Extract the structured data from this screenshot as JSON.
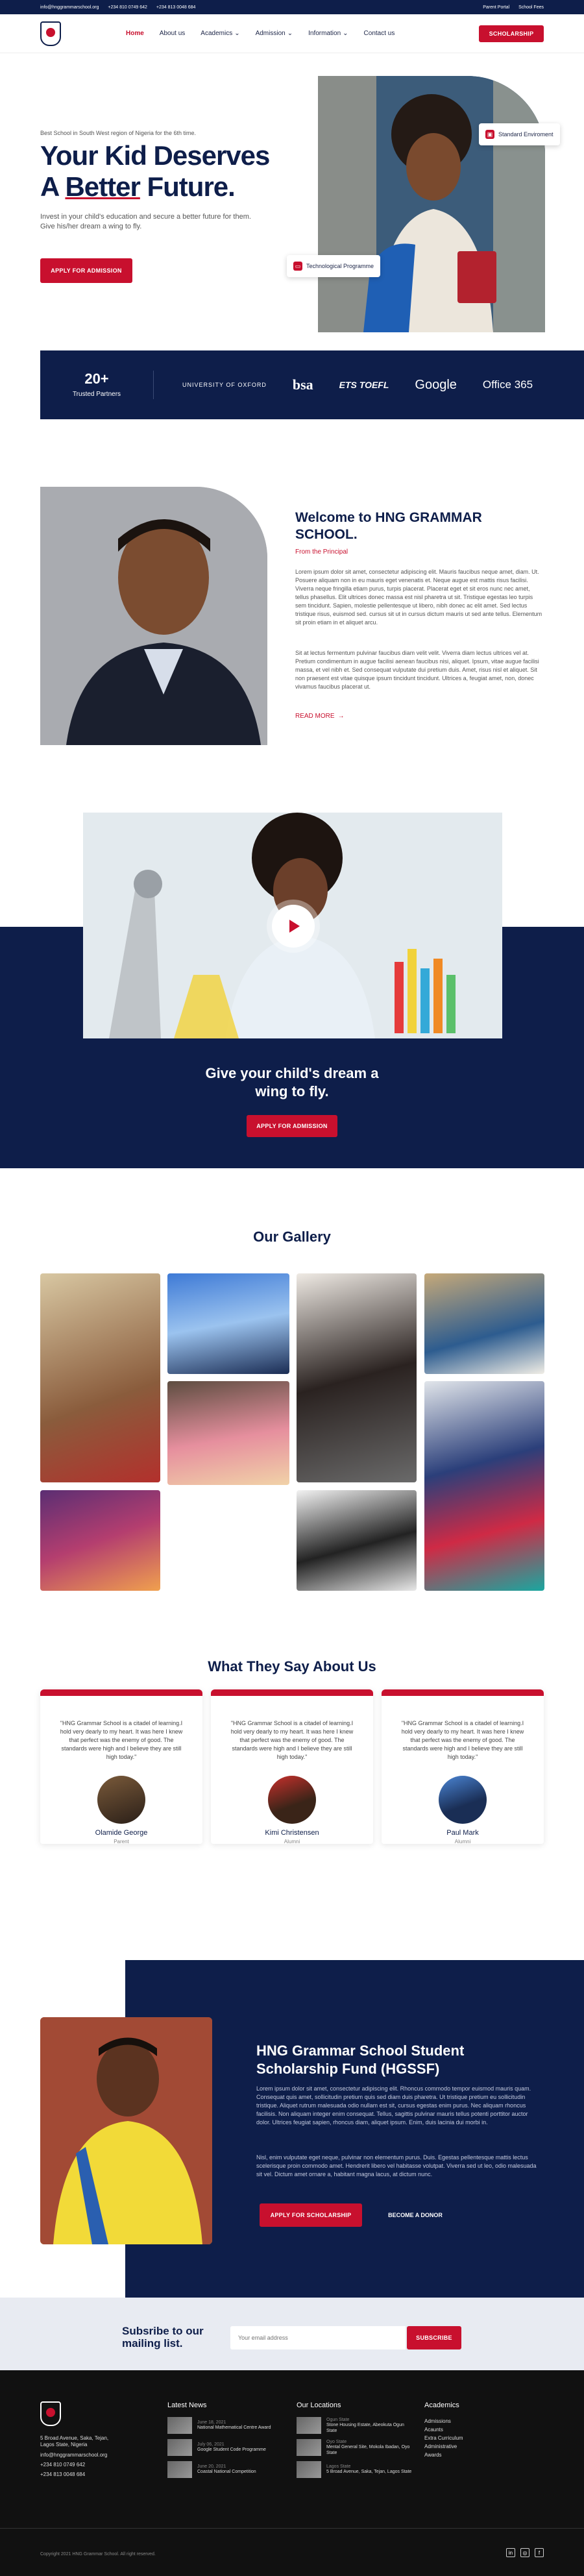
{
  "topbar": {
    "email": "info@hnggrammarschool.org",
    "phone1": "+234 810 0749 642",
    "phone2": "+234 813 0048 684",
    "parent_portal": "Parent Portal",
    "school_fees": "School Fees"
  },
  "nav": {
    "items": [
      {
        "label": "Home",
        "dropdown": false
      },
      {
        "label": "About us",
        "dropdown": false
      },
      {
        "label": "Academics",
        "dropdown": true
      },
      {
        "label": "Admission",
        "dropdown": true
      },
      {
        "label": "Information",
        "dropdown": true
      },
      {
        "label": "Contact us",
        "dropdown": false
      }
    ],
    "cta": "SCHOLARSHIP"
  },
  "hero": {
    "kicker": "Best School in South West region of Nigeria for the 6th time.",
    "title_a": "Your Kid Deserves",
    "title_b1": "A ",
    "title_b2": "Better",
    "title_b3": " Future.",
    "subtitle": "Invest in your child's education and secure a better future for them. Give his/her dream a wing to fly.",
    "cta": "APPLY FOR ADMISSION",
    "badge1": "Standard Enviroment",
    "badge2": "Technological Programme"
  },
  "partners": {
    "count": "20+",
    "label": "Trusted Partners",
    "logos": [
      "UNIVERSITY OF OXFORD",
      "bsa",
      "ETS TOEFL",
      "Google",
      "Office 365"
    ]
  },
  "welcome": {
    "title": "Welcome to HNG GRAMMAR SCHOOL.",
    "subtitle": "From the Principal",
    "p1": "Lorem ipsum dolor sit amet, consectetur adipiscing elit. Mauris faucibus neque amet, diam. Ut. Posuere aliquam non in eu mauris eget venenatis et. Neque augue est mattis risus facilisi. Viverra neque fringilla etiam purus, turpis placerat. Placerat eget et sit eros nunc nec amet, tellus phasellus. Elit ultrices donec massa est nisl pharetra ut sit. Tristique egestas leo turpis sem tincidunt. Sapien, molestie pellentesque ut libero, nibh donec ac elit amet. Sed lectus tristique risus, euismod sed. cursus sit ut in cursus dictum mauris ut sed ante tellus. Elementum sit proin etiam in et aliquet arcu.",
    "p2": "Sit at lectus fermentum pulvinar faucibus diam velit velit. Viverra diam lectus ultrices vel at. Pretium condimentum in augue facilisi aenean faucibus nisi, aliquet. Ipsum, vitae augue facilisi massa, et vel nibh et. Sed consequat vulputate dui pretium duis. Amet, risus nisl et aliquet. Sit non praesent est vitae quisque ipsum tincidunt tincidunt. Ultrices a, feugiat amet, non, donec vivamus faucibus placerat ut.",
    "read_more": "READ MORE"
  },
  "video": {
    "title_a": "Give your child's dream a",
    "title_b": "wing to fly.",
    "cta": "APPLY FOR ADMISSION"
  },
  "gallery": {
    "title": "Our Gallery"
  },
  "testimonials": {
    "title": "What They Say About Us",
    "quote": "\"HNG Grammar School is a citadel of learning.I hold very dearly to my heart. It was here I knew that perfect was the enemy of good. The standards were high and I believe they are still high today.\"",
    "people": [
      {
        "name": "Olamide George",
        "role": "Parent"
      },
      {
        "name": "Kimi Christensen",
        "role": "Alumni"
      },
      {
        "name": "Paul Mark",
        "role": "Alumni"
      }
    ]
  },
  "scholarship": {
    "title": "HNG Grammar School Student Scholarship Fund (HGSSF)",
    "p1": "Lorem ipsum dolor sit amet, consectetur adipiscing elit. Rhoncus commodo tempor euismod mauris quam. Consequat quis amet, sollicitudin pretium quis sed diam duis pharetra. Ut tristique pretium eu sollicitudin tristique. Aliquet rutrum malesuada odio nullam est sit, cursus egestas enim purus. Nec aliquam rhoncus facilisis. Non aliquam integer enim consequat. Tellus, sagittis pulvinar mauris tellus potenti porttitor auctor dolor. Ultrices feugiat sapien, rhoncus diam, aliquet ipsum. Enim, duis lacinia dui morbi in.",
    "p2": "Nisl, enim vulputate eget neque, pulvinar non elementum purus. Duis. Egestas pellentesque mattis lectus scelerisque proin commodo amet. Hendrerit libero vel habitasse volutpat. Viverra sed ut leo, odio malesuada sit vel. Dictum amet ornare a, habitant magna lacus, at dictum nunc.",
    "apply": "APPLY FOR SCHOLARSHIP",
    "donor": "BECOME A DONOR"
  },
  "newsletter": {
    "title": "Subsribe to our mailing list.",
    "placeholder": "Your email address",
    "cta": "SUBSCRIBE"
  },
  "footer": {
    "address": "5 Broad Avenue, Saka, Tejan, Lagos State, Nigeria",
    "email": "info@hnggrammarschool.org",
    "phone1": "+234 810 0749 642",
    "phone2": "+234 813 0048 684",
    "news_title": "Latest News",
    "news": [
      {
        "date": "June 18, 2021",
        "title": "National Mathematical Centre Award"
      },
      {
        "date": "July 06, 2021",
        "title": "Google Student Code Programme"
      },
      {
        "date": "June 20, 2021",
        "title": "Coastal National Competition"
      }
    ],
    "loc_title": "Our Locations",
    "locations": [
      {
        "name": "Ogun State",
        "addr": "Stone Housing Estate, Abeokuta Ogun State"
      },
      {
        "name": "Oyo State",
        "addr": "Mental General Site, Mokola Ibadan, Oyo State"
      },
      {
        "name": "Lagos State",
        "addr": "5 Broad Avenue, Saka, Tejan, Lagos State"
      }
    ],
    "acad_title": "Academics",
    "academics": [
      "Admissions",
      "Acaunts",
      "Extra Curriculum",
      "Administrative",
      "Awards"
    ],
    "copyright": "Copyright 2021 HNG Grammar School. All right reserved."
  },
  "colors": {
    "navy": "#0e1e4a",
    "red": "#c8102e"
  }
}
